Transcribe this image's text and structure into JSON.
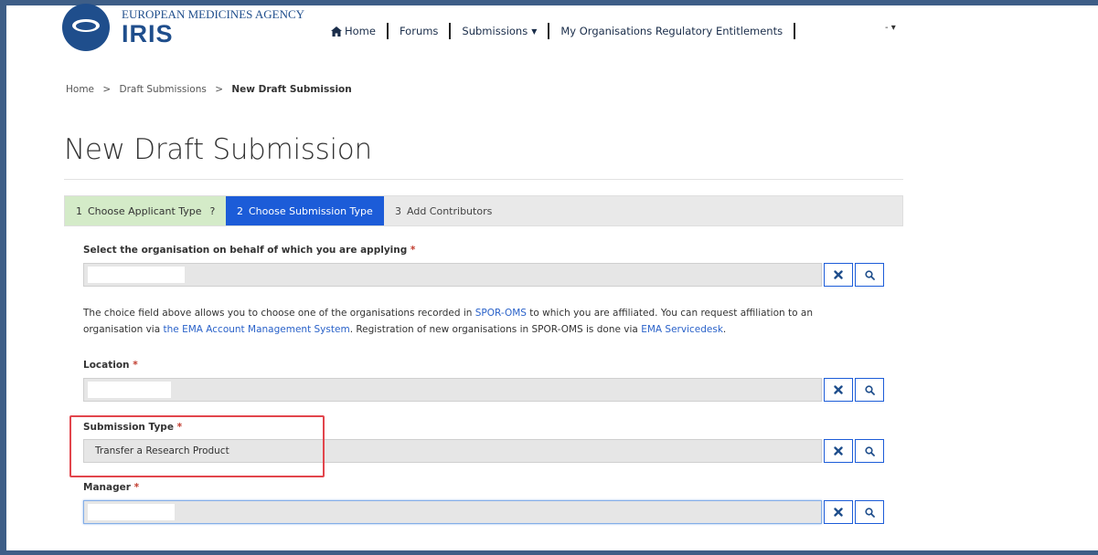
{
  "header": {
    "agency": "EUROPEAN MEDICINES AGENCY",
    "brand": "IRIS",
    "nav": [
      {
        "label": "Home",
        "icon": "home-icon"
      },
      {
        "label": "Forums"
      },
      {
        "label": "Submissions",
        "has_dropdown": true
      },
      {
        "label": "My Organisations Regulatory Entitlements"
      }
    ],
    "user_menu_label": "- ▾"
  },
  "breadcrumb": {
    "items": [
      "Home",
      "Draft Submissions",
      "New Draft Submission"
    ],
    "separator": ">"
  },
  "page_title": "New Draft Submission",
  "wizard": {
    "steps": [
      {
        "number": "1",
        "label": "Choose Applicant Type",
        "suffix": "?",
        "state": "completed"
      },
      {
        "number": "2",
        "label": "Choose Submission Type",
        "state": "active"
      },
      {
        "number": "3",
        "label": "Add Contributors",
        "state": "pending"
      }
    ]
  },
  "form": {
    "organisation": {
      "label": "Select the organisation on behalf of which you are applying",
      "required_mark": "*",
      "value": ""
    },
    "info": {
      "t1": "The choice field above allows you to choose one of the organisations recorded in ",
      "link1": "SPOR-OMS",
      "t2": " to which you are affiliated. You can request affiliation to an organisation via ",
      "link2": "the EMA Account Management System",
      "t3": ". Registration of new organisations in SPOR-OMS is done via ",
      "link3": "EMA Servicedesk",
      "t4": "."
    },
    "location": {
      "label": "Location",
      "required_mark": "*",
      "value": ""
    },
    "submission_type": {
      "label": "Submission Type",
      "required_mark": "*",
      "value": "Transfer a Research Product"
    },
    "manager": {
      "label": "Manager",
      "required_mark": "*",
      "value": ""
    }
  },
  "colors": {
    "brand": "#1f4e8c",
    "wizard_active": "#1c5cd8",
    "wizard_completed": "#d4ebc8",
    "highlight_box": "#e2454c",
    "link": "#2a62c9"
  }
}
